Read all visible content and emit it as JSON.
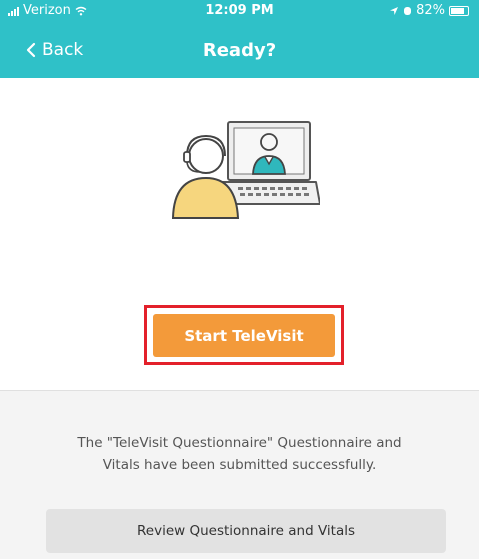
{
  "status_bar": {
    "carrier": "Verizon",
    "time": "12:09 PM",
    "battery_percent": "82%"
  },
  "nav": {
    "back_label": "Back",
    "title": "Ready?"
  },
  "illustration": {
    "icon": "televisit-doctor-laptop-icon",
    "colors": {
      "patient_body": "#f6d67e",
      "doctor_body": "#2fb7bc",
      "outline": "#555555"
    }
  },
  "start_button": {
    "label": "Start TeleVisit",
    "color": "#f39a3a",
    "highlight_color": "#e3202a"
  },
  "confirmation": {
    "message_line1": "The \"TeleVisit Questionnaire\" Questionnaire and",
    "message_line2": "Vitals have been submitted successfully."
  },
  "review_button": {
    "label": "Review Questionnaire and Vitals"
  },
  "theme": {
    "header_color": "#2fc1c8"
  }
}
